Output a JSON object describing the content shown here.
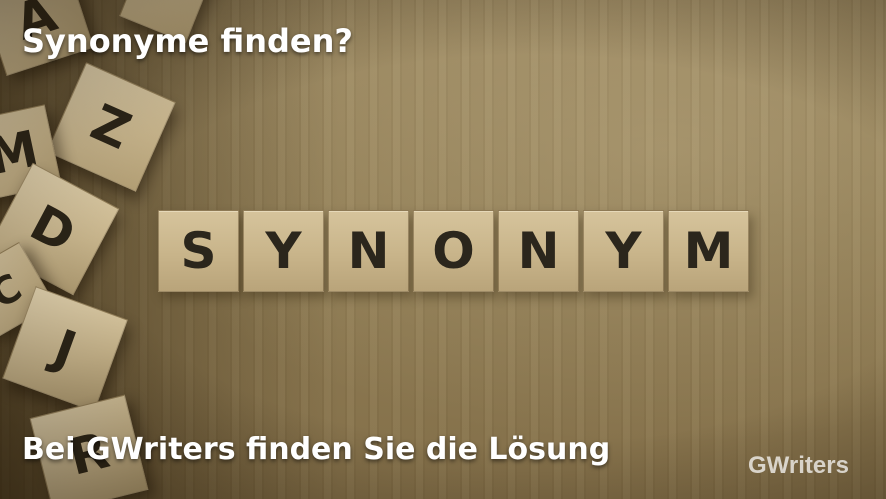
{
  "headline": "Synonyme finden?",
  "subline": "Bei GWriters finden Sie die Lösung",
  "logo": "GWriters",
  "tiles": [
    "S",
    "Y",
    "N",
    "O",
    "N",
    "Y",
    "M"
  ],
  "cubes": [
    "A",
    "Z",
    "M",
    "D",
    "C",
    "J",
    "R"
  ]
}
